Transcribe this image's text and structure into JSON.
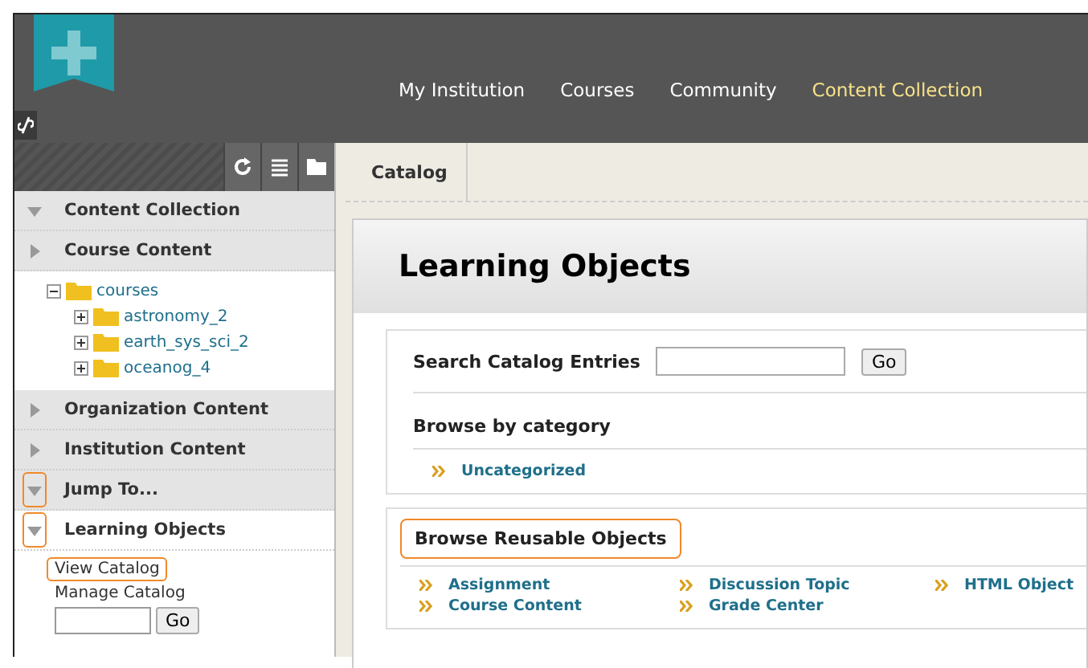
{
  "header": {
    "nav": [
      {
        "label": "My Institution",
        "selected": false
      },
      {
        "label": "Courses",
        "selected": false
      },
      {
        "label": "Community",
        "selected": false
      },
      {
        "label": "Content Collection",
        "selected": true
      }
    ]
  },
  "sidebar": {
    "sections": [
      {
        "label": "Content Collection",
        "expanded": true,
        "shaded": true,
        "arrow_highlighted": false
      },
      {
        "label": "Course Content",
        "expanded": false,
        "shaded": true,
        "arrow_highlighted": false,
        "tree": [
          {
            "label": "courses",
            "expanded": true,
            "children": [
              {
                "label": "astronomy_2",
                "expanded": false
              },
              {
                "label": "earth_sys_sci_2",
                "expanded": false
              },
              {
                "label": "oceanog_4",
                "expanded": false
              }
            ]
          }
        ]
      },
      {
        "label": "Organization Content",
        "expanded": false,
        "shaded": true,
        "arrow_highlighted": false
      },
      {
        "label": "Institution Content",
        "expanded": false,
        "shaded": true,
        "arrow_highlighted": false
      },
      {
        "label": "Jump To...",
        "expanded": true,
        "shaded": true,
        "arrow_highlighted": true
      },
      {
        "label": "Learning Objects",
        "expanded": true,
        "shaded": false,
        "arrow_highlighted": true,
        "links": [
          {
            "label": "View Catalog",
            "highlighted": true
          },
          {
            "label": "Manage Catalog",
            "highlighted": false
          }
        ],
        "go": "Go"
      }
    ]
  },
  "breadcrumb": "Catalog",
  "page_title": "Learning Objects",
  "search": {
    "label": "Search Catalog Entries",
    "button": "Go"
  },
  "browse_category": {
    "title": "Browse by category",
    "links": [
      "Uncategorized"
    ]
  },
  "browse_reusable": {
    "title": "Browse Reusable Objects",
    "highlighted": true,
    "links": [
      "Assignment",
      "Discussion Topic",
      "HTML Object",
      "Course Content",
      "Grade Center"
    ]
  }
}
